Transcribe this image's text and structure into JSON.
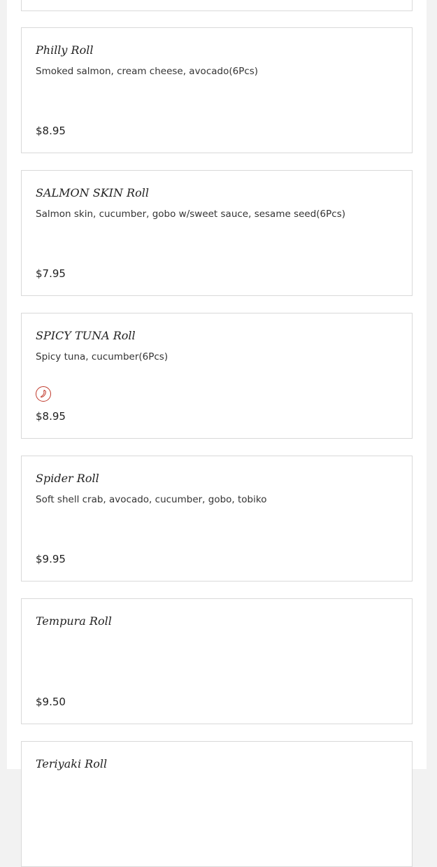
{
  "menu_items": [
    {
      "name": "Philly Roll",
      "description": "Smoked salmon, cream cheese, avocado(6Pcs)",
      "price": "$8.95",
      "spicy": false
    },
    {
      "name": "SALMON SKIN Roll",
      "description": "Salmon skin, cucumber, gobo w/sweet sauce, sesame seed(6Pcs)",
      "price": "$7.95",
      "spicy": false
    },
    {
      "name": "SPICY TUNA Roll",
      "description": "Spicy tuna, cucumber(6Pcs)",
      "price": "$8.95",
      "spicy": true,
      "icon": "chili-pepper-icon"
    },
    {
      "name": "Spider Roll",
      "description": "Soft shell crab, avocado, cucumber, gobo, tobiko",
      "price": "$9.95",
      "spicy": false
    },
    {
      "name": "Tempura Roll",
      "description": "",
      "price": "$9.50",
      "spicy": false
    },
    {
      "name": "Teriyaki Roll",
      "description": "",
      "price": "",
      "spicy": false
    }
  ],
  "colors": {
    "spicy_accent": "#c0392b",
    "card_border": "#d9d9d9",
    "page_background": "#f2f2f2"
  }
}
